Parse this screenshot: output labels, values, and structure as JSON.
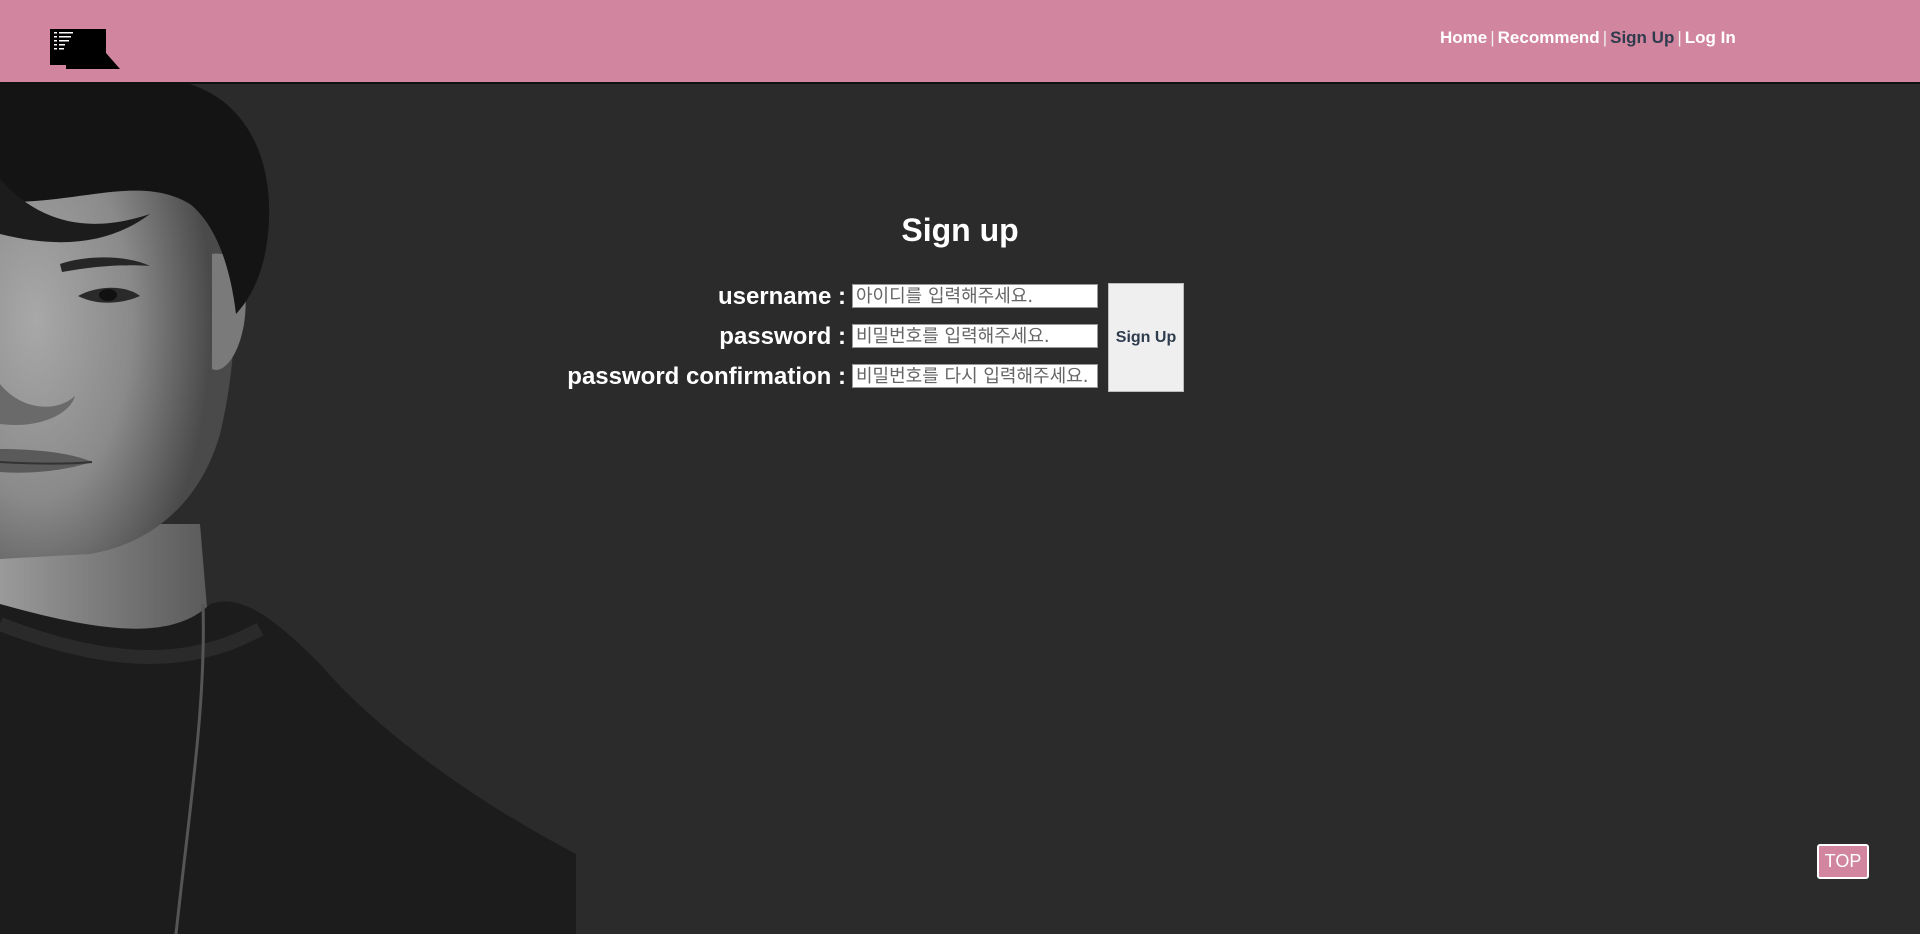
{
  "nav": {
    "home": "Home",
    "recommend": "Recommend",
    "signup": "Sign Up",
    "login": "Log In",
    "separator": "|"
  },
  "form": {
    "title": "Sign up",
    "username_label": "username :",
    "username_placeholder": "아이디를 입력해주세요.",
    "password_label": "password :",
    "password_placeholder": "비밀번호를 입력해주세요.",
    "confirm_label": "password confirmation :",
    "confirm_placeholder": "비밀번호를 다시 입력해주세요.",
    "submit_label": "Sign Up"
  },
  "top_button": "TOP",
  "colors": {
    "header_bg": "#d1859e",
    "page_bg": "#2b2b2b",
    "active_nav": "#2f3c4e"
  }
}
